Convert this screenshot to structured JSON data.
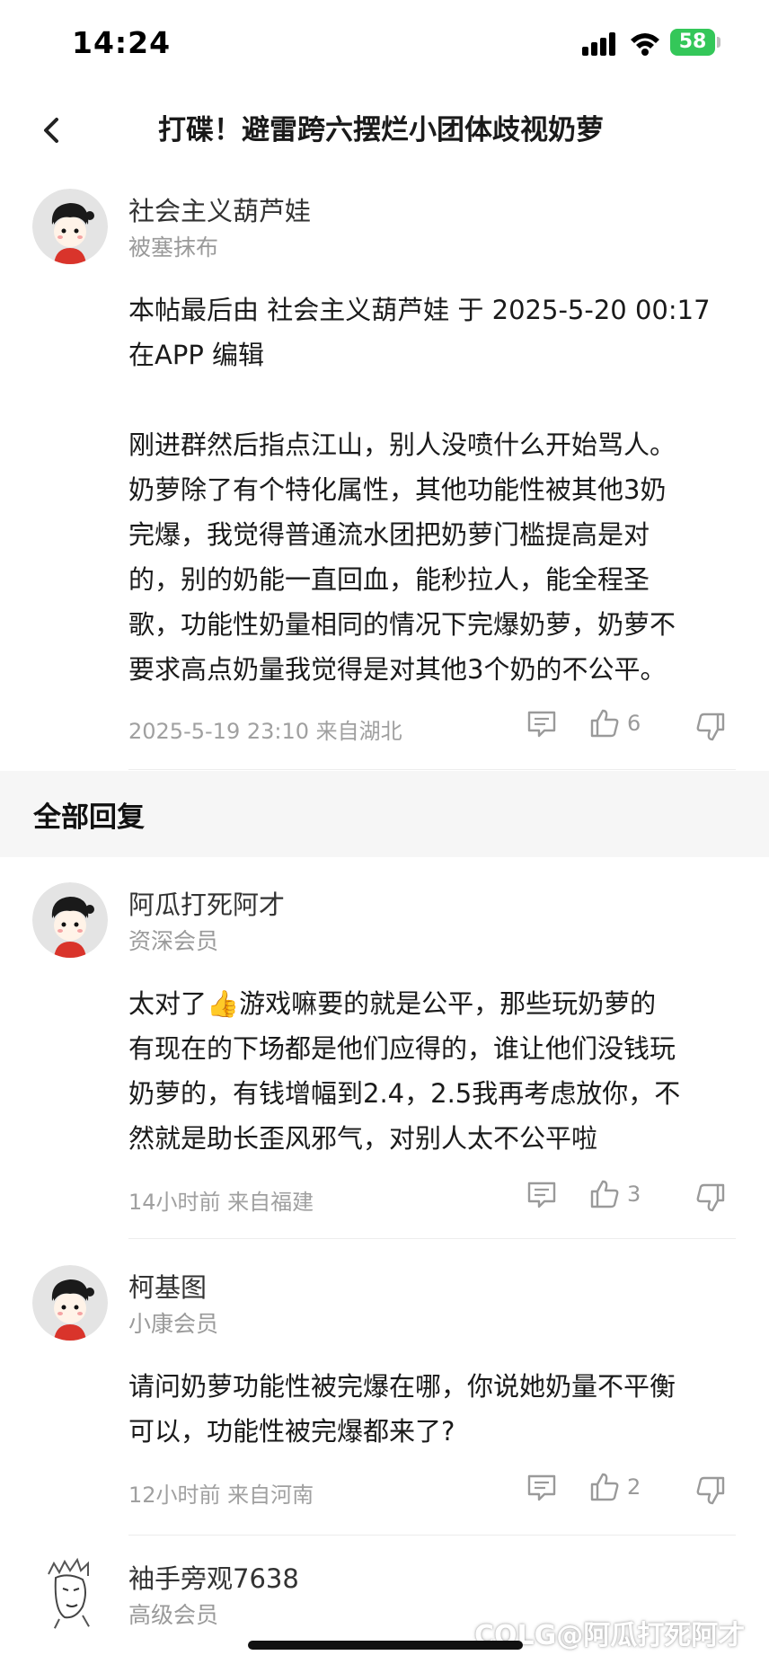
{
  "status_bar": {
    "time": "14:24",
    "battery": "58"
  },
  "nav": {
    "title": "打碟！避雷跨六摆烂小团体歧视奶萝"
  },
  "main_post": {
    "author": "社会主义葫芦娃",
    "rank": "被塞抹布",
    "content_lines": [
      "本帖最后由 社会主义葫芦娃 于 2025-5-20 00:17",
      "在APP 编辑",
      "",
      "刚进群然后指点江山，别人没喷什么开始骂人。",
      "奶萝除了有个特化属性，其他功能性被其他3奶",
      "完爆，我觉得普通流水团把奶萝门槛提高是对",
      "的，别的奶能一直回血，能秒拉人，能全程圣",
      "歌，功能性奶量相同的情况下完爆奶萝，奶萝不",
      "要求高点奶量我觉得是对其他3个奶的不公平。"
    ],
    "meta": "2025-5-19 23:10  来自湖北",
    "likes": "6"
  },
  "section": {
    "title": "全部回复"
  },
  "replies": [
    {
      "author": "阿瓜打死阿才",
      "rank": "资深会员",
      "content_lines": [
        "太对了👍游戏嘛要的就是公平，那些玩奶萝的",
        "有现在的下场都是他们应得的，谁让他们没钱玩",
        "奶萝的，有钱增幅到2.4，2.5我再考虑放你，不",
        "然就是助长歪风邪气，对别人太不公平啦"
      ],
      "meta": "14小时前 来自福建",
      "likes": "3"
    },
    {
      "author": "柯基图",
      "rank": "小康会员",
      "content_lines": [
        "请问奶萝功能性被完爆在哪，你说她奶量不平衡",
        "可以，功能性被完爆都来了?"
      ],
      "meta": "12小时前 来自河南",
      "likes": "2"
    },
    {
      "author": "袖手旁观7638",
      "rank": "高级会员"
    }
  ],
  "watermark": "COLG@阿瓜打死阿才",
  "icons": {
    "back": "chevron-left-icon",
    "comment": "comment-icon",
    "like": "thumbs-up-icon",
    "dislike": "thumbs-down-icon"
  },
  "colors": {
    "battery": "#34c759",
    "section_band": "#f6f6f6",
    "meta_text": "#a0a0a0"
  }
}
